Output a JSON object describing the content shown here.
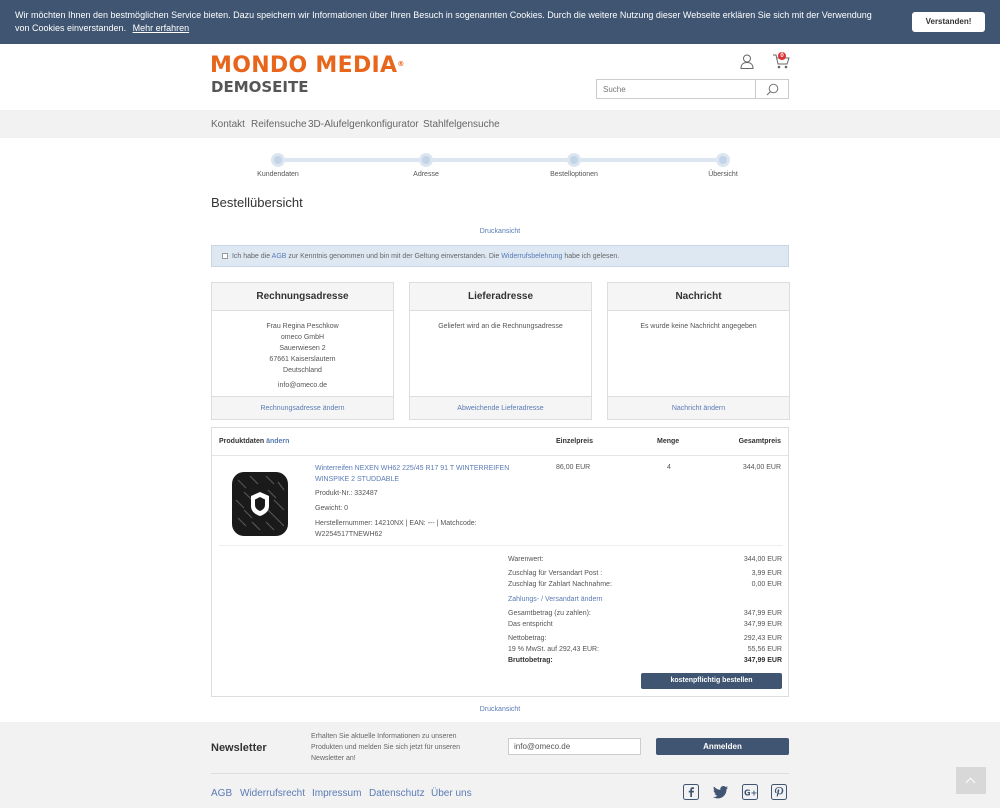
{
  "cookie": {
    "text": "Wir möchten Ihnen den bestmöglichen Service bieten. Dazu speichern wir Informationen über Ihren Besuch in sogenannten Cookies. Durch die weitere Nutzung dieser Webseite erklären Sie sich mit der Verwendung von Cookies einverstanden.",
    "link": "Mehr erfahren",
    "button": "Verstanden!"
  },
  "header": {
    "logo_main": "MONDO MEDIA",
    "logo_reg": "®",
    "logo_sub": "DEMOSEITE",
    "cart_count": "0",
    "search_placeholder": "Suche"
  },
  "nav": [
    "Kontakt",
    "Reifensuche",
    "3D-Alufelgenkonfigurator",
    "Stahlfelgensuche"
  ],
  "steps": [
    "Kundendaten",
    "Adresse",
    "Bestelloptionen",
    "Übersicht"
  ],
  "page_title": "Bestellübersicht",
  "print_link": "Druckansicht",
  "agb": {
    "t1": "Ich habe die",
    "l1": "AGB",
    "t2": "zur Kenntnis genommen und bin mit der Geltung einverstanden. Die",
    "l2": "Widerrufsbelehrung",
    "t3": "habe ich gelesen."
  },
  "billing": {
    "title": "Rechnungsadresse",
    "lines": [
      "Frau Regina Peschkow",
      "omeco GmbH",
      "Sauerwiesen 2",
      "67661 Kaiserslautern",
      "Deutschland"
    ],
    "email": "info@omeco.de",
    "action": "Rechnungsadresse ändern"
  },
  "delivery": {
    "title": "Lieferadresse",
    "text": "Geliefert wird an die Rechnungsadresse",
    "action": "Abweichende Lieferadresse"
  },
  "message": {
    "title": "Nachricht",
    "text": "Es wurde keine Nachricht angegeben",
    "action": "Nachricht ändern"
  },
  "table": {
    "h_product": "Produktdaten",
    "h_change": "ändern",
    "h_unit": "Einzelpreis",
    "h_qty": "Menge",
    "h_total": "Gesamtpreis"
  },
  "product": {
    "name": "Winterreifen NEXEN WH62 225/45 R17 91 T WINTERREIFEN WINSPIKE 2 STUDDABLE",
    "number": "Produkt-Nr.: 332487",
    "weight": "Gewicht: 0",
    "codes": "Herstellernummer: 14210NX | EAN: --- | Matchcode: W2254517TNEWH62",
    "unit_price": "86,00 EUR",
    "qty": "4",
    "total": "344,00 EUR"
  },
  "summary": {
    "rows": [
      {
        "label": "Warenwert:",
        "value": "344,00 EUR"
      },
      {
        "label": "Zuschlag für Versandart Post :",
        "value": "3,99 EUR"
      },
      {
        "label": "Zuschlag für Zahlart Nachnahme:",
        "value": "0,00 EUR"
      },
      {
        "label": "Gesamtbetrag (zu zahlen):",
        "value": "347,99 EUR"
      },
      {
        "label": "Das entspricht",
        "value": "347,99 EUR"
      },
      {
        "label": "Nettobetrag:",
        "value": "292,43 EUR"
      },
      {
        "label": "19 % MwSt. auf 292,43 EUR:",
        "value": "55,56 EUR"
      },
      {
        "label": "Bruttobetrag:",
        "value": "347,99 EUR"
      }
    ],
    "change_link": "Zahlungs- / Versandart ändern",
    "order_button": "kostenpflichtig bestellen"
  },
  "newsletter": {
    "title": "Newsletter",
    "text": "Erhalten Sie aktuelle Informationen zu unseren Produkten und melden Sie sich jetzt für unseren Newsletter an!",
    "email_value": "info@omeco.de",
    "button": "Anmelden"
  },
  "footer_links": [
    "AGB",
    "Widerrufsrecht",
    "Impressum",
    "Datenschutz",
    "Über uns"
  ],
  "social_icons": [
    "facebook-icon",
    "twitter-icon",
    "google-plus-icon",
    "pinterest-icon"
  ],
  "colors": {
    "brand_orange": "#e8661b",
    "brand_navy": "#3f5571",
    "link_blue": "#5a7bb5"
  }
}
